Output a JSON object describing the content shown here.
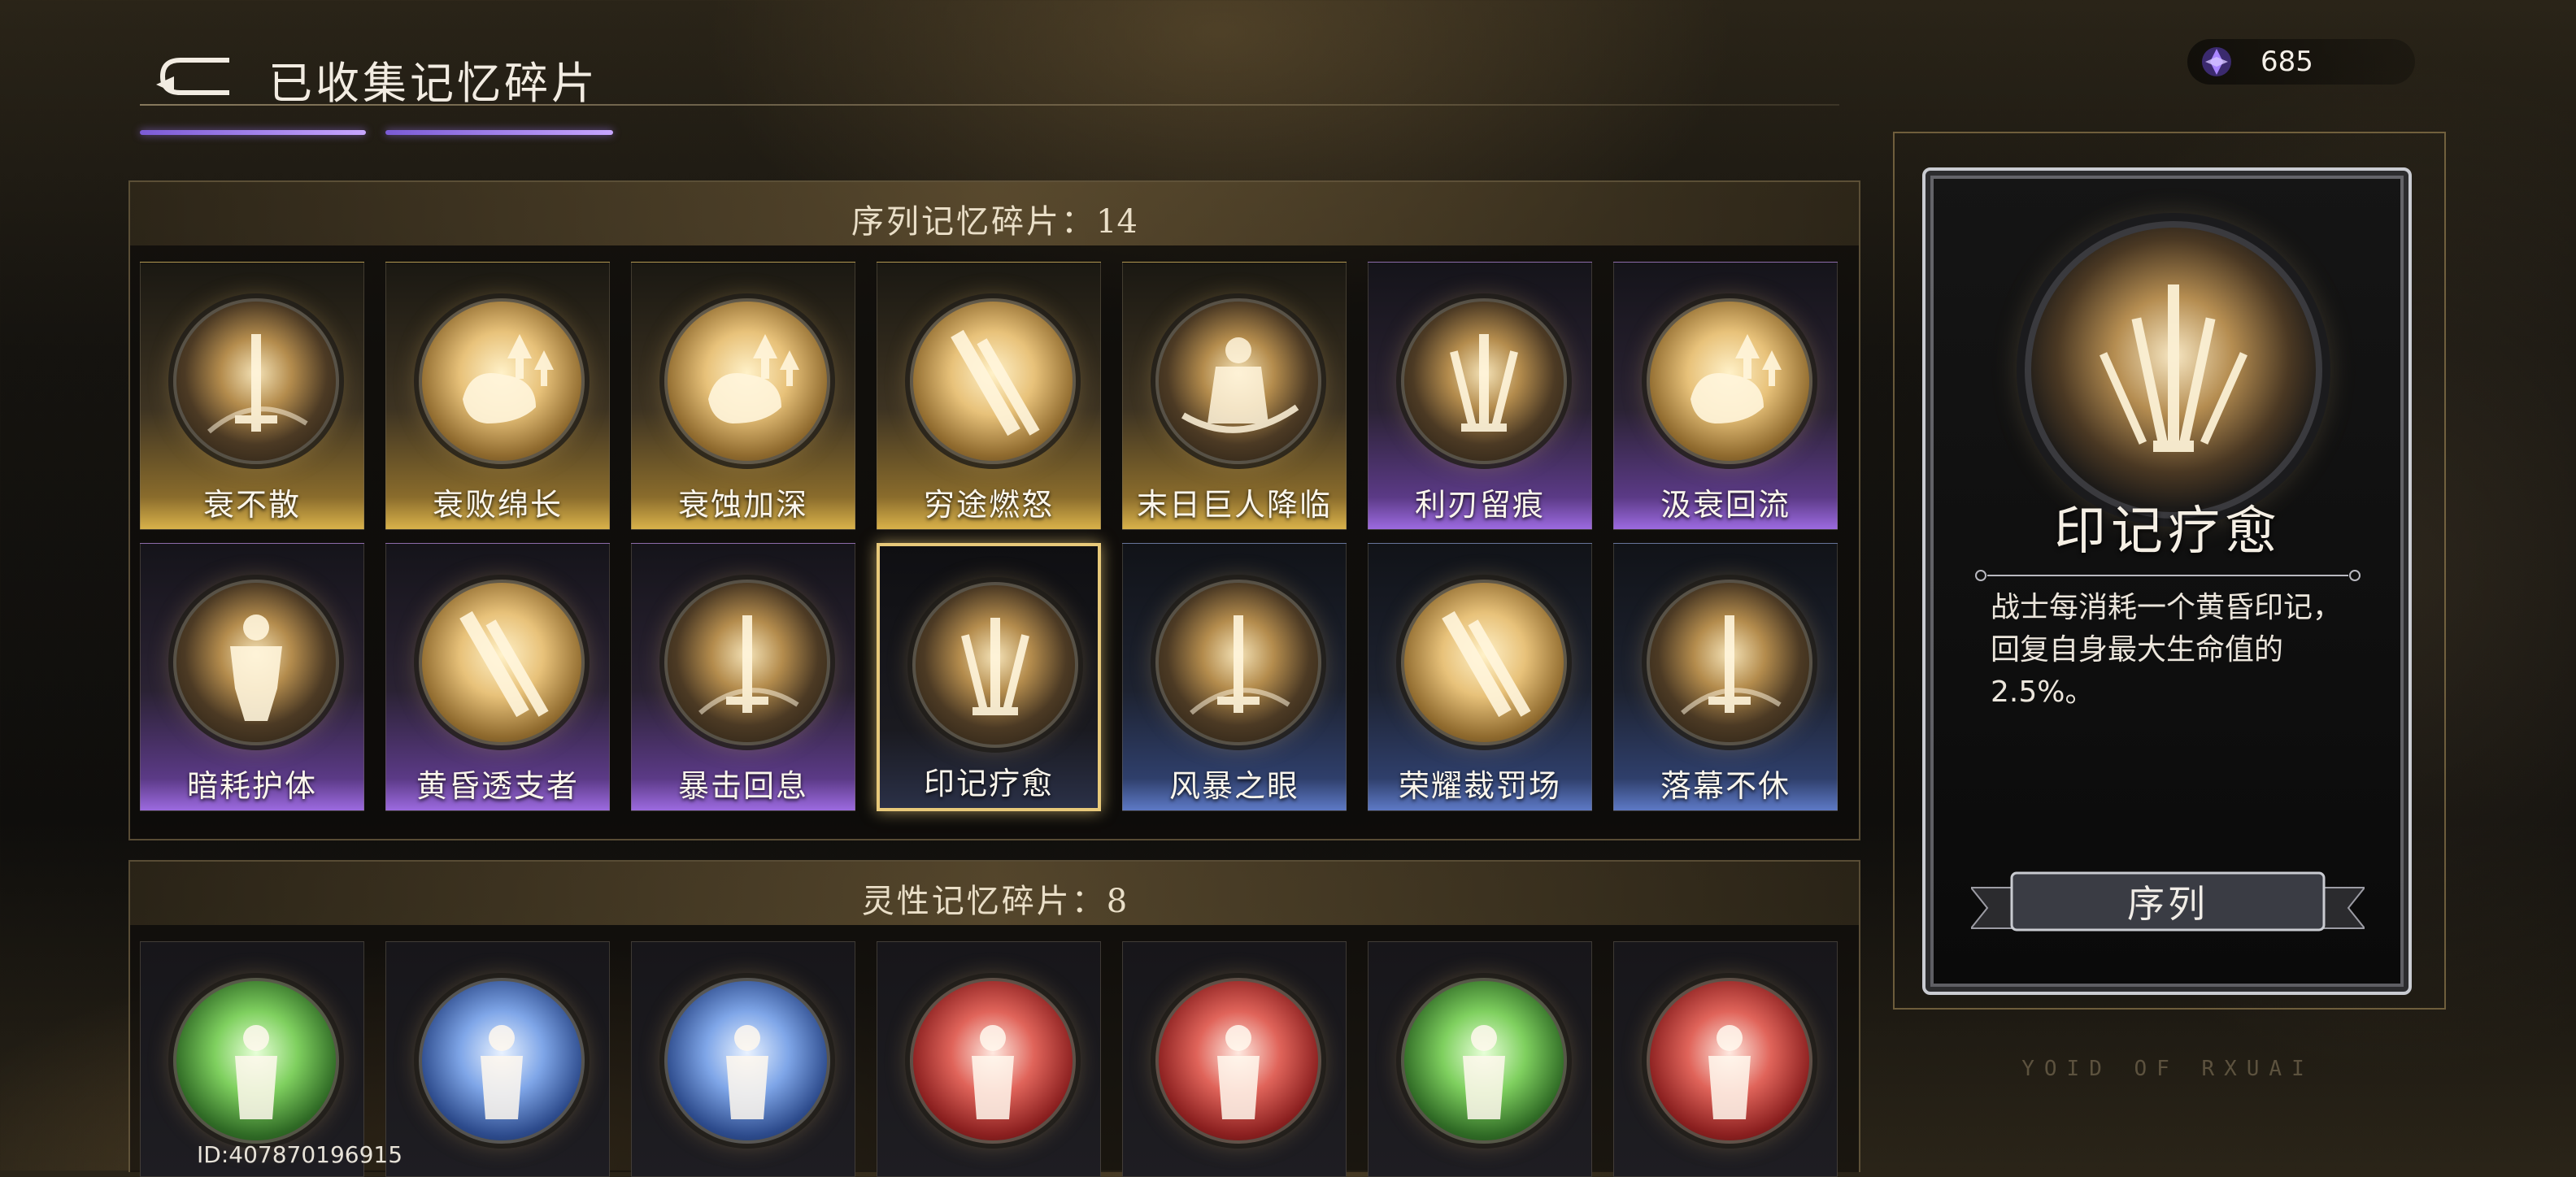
{
  "header": {
    "title": "已收集记忆碎片",
    "currency_value": "685"
  },
  "sequence_section": {
    "label": "序列记忆碎片：",
    "count": "14",
    "cards": [
      {
        "name": "衰不散",
        "frame": "gold",
        "orb": "dark",
        "icon": "sword"
      },
      {
        "name": "衰败绵长",
        "frame": "gold",
        "orb": "gold",
        "icon": "fist-up"
      },
      {
        "name": "衰蚀加深",
        "frame": "gold",
        "orb": "gold",
        "icon": "fist-up"
      },
      {
        "name": "穷途燃怒",
        "frame": "gold",
        "orb": "gold",
        "icon": "blades"
      },
      {
        "name": "末日巨人降临",
        "frame": "gold",
        "orb": "dark",
        "icon": "warrior"
      },
      {
        "name": "利刃留痕",
        "frame": "purple",
        "orb": "dark",
        "icon": "swords"
      },
      {
        "name": "汲衰回流",
        "frame": "purple",
        "orb": "gold",
        "icon": "fist-up"
      },
      {
        "name": "暗耗护体",
        "frame": "purple",
        "orb": "dark",
        "icon": "figure"
      },
      {
        "name": "黄昏透支者",
        "frame": "purple",
        "orb": "gold",
        "icon": "blades"
      },
      {
        "name": "暴击回息",
        "frame": "purple",
        "orb": "dark",
        "icon": "sword"
      },
      {
        "name": "印记疗愈",
        "frame": "selected",
        "orb": "dark",
        "icon": "swords"
      },
      {
        "name": "风暴之眼",
        "frame": "blue",
        "orb": "dark",
        "icon": "sword"
      },
      {
        "name": "荣耀裁罚场",
        "frame": "blue",
        "orb": "gold",
        "icon": "blades"
      },
      {
        "name": "落幕不休",
        "frame": "blue",
        "orb": "dark",
        "icon": "sword"
      }
    ]
  },
  "spirit_section": {
    "label": "灵性记忆碎片：",
    "count": "8",
    "orbs": [
      "green",
      "blue",
      "blue",
      "red",
      "red",
      "green",
      "red"
    ]
  },
  "detail": {
    "name": "印记疗愈",
    "description": "战士每消耗一个黄昏印记，回复自身最大生命值的2.5%。",
    "category": "序列",
    "watermark": "YOID OF RXUAI"
  },
  "footer": {
    "player_id": "ID:407870196915"
  },
  "colors": {
    "accent_purple": "#9c6ae0",
    "gold": "#d9b24a",
    "selected_border": "#e8c97a"
  }
}
